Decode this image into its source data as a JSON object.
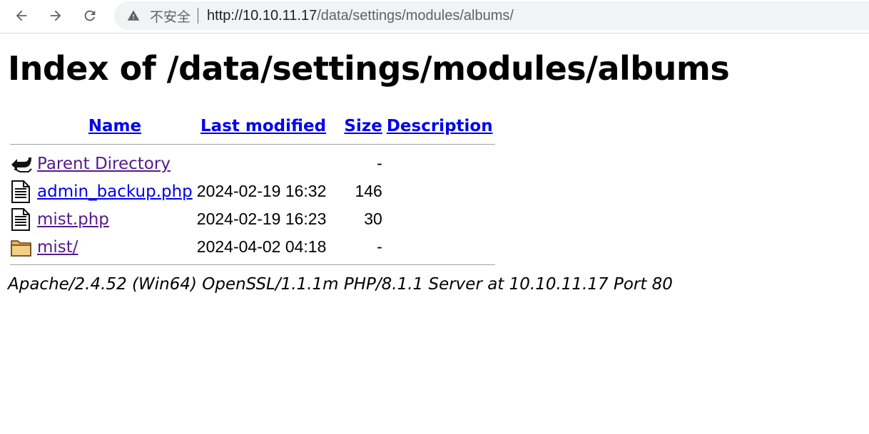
{
  "browser": {
    "insecure_label": "不安全",
    "url_host": "http://10.10.11.17",
    "url_path": "/data/settings/modules/albums/"
  },
  "page": {
    "title": "Index of /data/settings/modules/albums",
    "columns": {
      "name": "Name",
      "last_modified": "Last modified",
      "size": "Size",
      "description": "Description"
    },
    "rows": [
      {
        "icon": "back-icon",
        "name": "Parent Directory",
        "modified": "",
        "size": "-",
        "desc": ""
      },
      {
        "icon": "text-file-icon",
        "name": "admin_backup.php",
        "modified": "2024-02-19 16:32",
        "size": "146",
        "desc": ""
      },
      {
        "icon": "text-file-icon",
        "name": "mist.php",
        "modified": "2024-02-19 16:23",
        "size": "30",
        "desc": ""
      },
      {
        "icon": "folder-icon",
        "name": "mist/",
        "modified": "2024-04-02 04:18",
        "size": "-",
        "desc": ""
      }
    ],
    "footer": "Apache/2.4.52 (Win64) OpenSSL/1.1.1m PHP/8.1.1 Server at 10.10.11.17 Port 80"
  }
}
